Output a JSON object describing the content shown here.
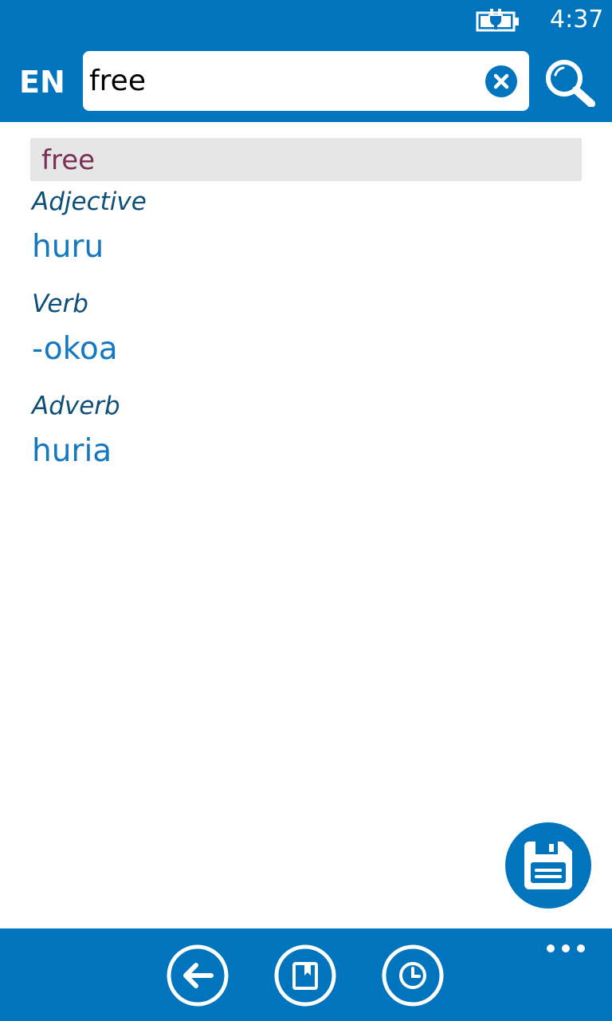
{
  "status_bar": {
    "time": "4:37",
    "battery_icon": "battery-charging-icon"
  },
  "header": {
    "language": "EN",
    "search": {
      "value": "free",
      "placeholder": ""
    },
    "clear_icon": "close-circle-icon",
    "search_icon": "search-icon"
  },
  "entry": {
    "headword": "free",
    "senses": [
      {
        "pos": "Adjective",
        "translation": "huru"
      },
      {
        "pos": "Verb",
        "translation": "-okoa"
      },
      {
        "pos": "Adverb",
        "translation": "huria"
      }
    ]
  },
  "fab": {
    "icon": "save-icon"
  },
  "app_bar": {
    "buttons": [
      {
        "icon": "back-arrow-icon"
      },
      {
        "icon": "bookmark-icon"
      },
      {
        "icon": "history-clock-icon"
      }
    ],
    "more": "..."
  },
  "colors": {
    "accent": "#0074bd",
    "headword_text": "#7a2f55",
    "pos_text": "#0d4f78",
    "translation_text": "#1478c0",
    "headword_bg": "#e6e6e6"
  }
}
